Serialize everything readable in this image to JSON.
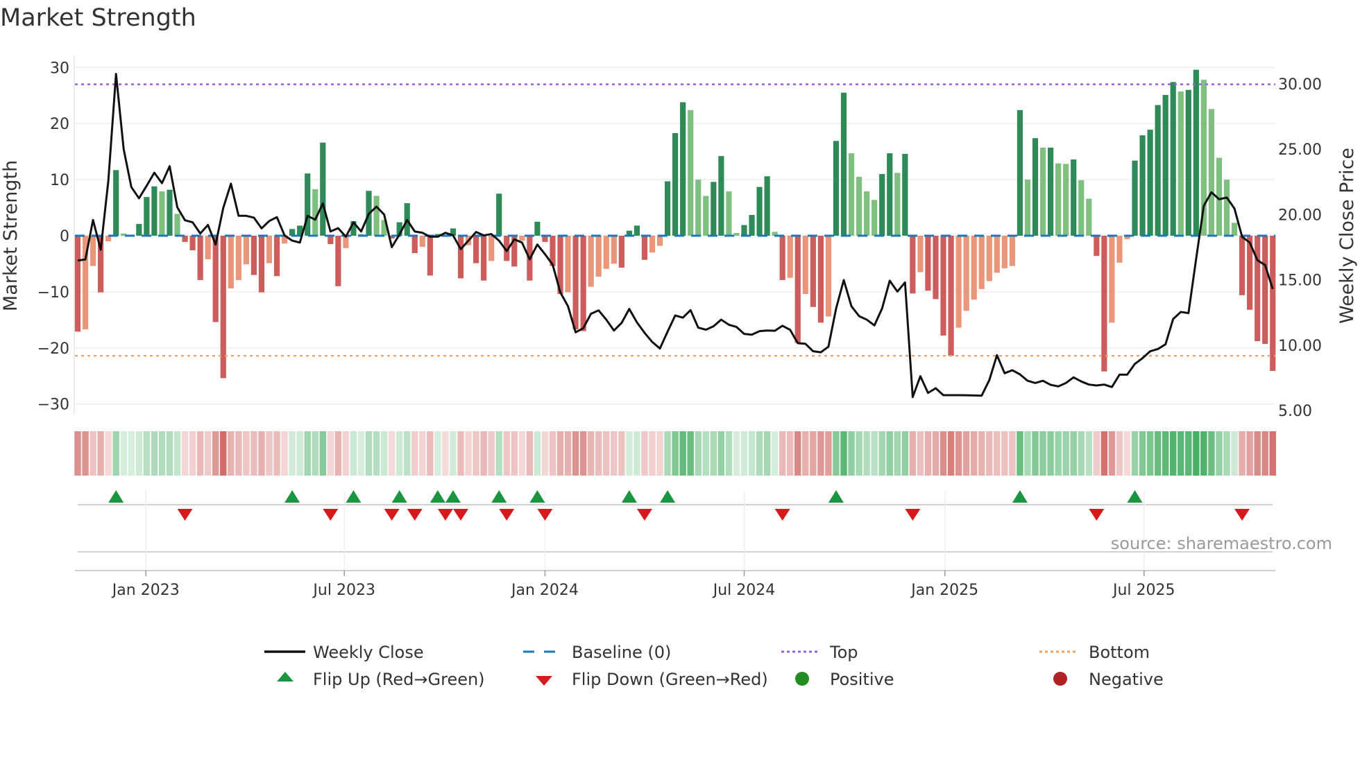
{
  "title": "Market Strength",
  "source": "source: sharemaestro.com",
  "colors": {
    "pos_rising": "#2e8b57",
    "pos_falling": "#7fbf7f",
    "neg_falling": "#cd5c5c",
    "neg_rising": "#e9967a",
    "close": "#111111",
    "baseline": "#1f77b4",
    "top": "#9b5de5",
    "bottom": "#f4a261",
    "flip_up": "#1a9641",
    "flip_down": "#d7191c",
    "positive": "#228b22",
    "negative": "#b22222"
  },
  "legend": {
    "weekly_close": "Weekly Close",
    "baseline": "Baseline (0)",
    "top": "Top",
    "bottom": "Bottom",
    "flip_up": "Flip Up (Red→Green)",
    "flip_down": "Flip Down (Green→Red)",
    "positive": "Positive",
    "negative": "Negative"
  },
  "chart_data": {
    "type": "bar",
    "title": "Market Strength",
    "ylabel": "Market Strength",
    "y2label": "Weekly Close Price",
    "ylim": [
      -32,
      32
    ],
    "y2lim": [
      4.5,
      31.5
    ],
    "yticks": [
      30,
      20,
      10,
      0,
      -10,
      -20,
      -30
    ],
    "ytick_labels": [
      "30",
      "20",
      "10",
      "0",
      "−10",
      "−20",
      "−30"
    ],
    "y2ticks": [
      30,
      25,
      20,
      15,
      10,
      5
    ],
    "y2tick_labels": [
      "30.00",
      "25.00",
      "20.00",
      "15.00",
      "10.00",
      "5.00"
    ],
    "top_level": 27,
    "bottom_level": -21.4,
    "baseline": 0,
    "x_ticks": [
      {
        "label": "Jan 2023",
        "week": 8.9
      },
      {
        "label": "Jul 2023",
        "week": 34.8
      },
      {
        "label": "Jan 2024",
        "week": 61.0
      },
      {
        "label": "Jul 2024",
        "week": 87.0
      },
      {
        "label": "Jan 2025",
        "week": 113.2
      },
      {
        "label": "Jul 2025",
        "week": 139.2
      }
    ],
    "strength": [
      -17.1,
      -16.7,
      -5.4,
      -10.1,
      -1.0,
      11.7,
      0.4,
      0.2,
      2.1,
      6.9,
      8.8,
      7.9,
      8.2,
      3.9,
      -1.1,
      -2.6,
      -7.9,
      -4.2,
      -15.4,
      -25.4,
      -9.4,
      -7.9,
      -5.1,
      -7.0,
      -10.1,
      -4.9,
      -7.2,
      -1.4,
      1.2,
      1.8,
      11.1,
      8.3,
      16.6,
      -1.5,
      -9.0,
      -2.2,
      2.6,
      0.3,
      8.0,
      7.1,
      2.8,
      -0.5,
      2.4,
      5.8,
      -3.1,
      -2.0,
      -7.1,
      0.3,
      -0.2,
      1.3,
      -7.6,
      -1.7,
      -4.9,
      -8.0,
      -4.5,
      7.5,
      -4.5,
      -5.5,
      -0.9,
      -8.0,
      2.5,
      -1.1,
      -5.4,
      -10.4,
      -10.1,
      -16.7,
      -17.0,
      -9.1,
      -7.3,
      -5.9,
      -5.0,
      -5.7,
      0.9,
      1.8,
      -4.3,
      -3.0,
      -1.8,
      9.7,
      18.3,
      23.8,
      22.4,
      10.0,
      7.1,
      9.6,
      14.2,
      7.9,
      0.5,
      1.9,
      3.7,
      8.7,
      10.6,
      0.7,
      -7.9,
      -7.5,
      -19.1,
      -10.4,
      -12.7,
      -15.5,
      -14.4,
      16.9,
      25.5,
      14.7,
      10.5,
      7.9,
      6.4,
      11.0,
      14.7,
      11.2,
      14.6,
      -10.3,
      -6.5,
      -9.8,
      -11.3,
      -17.8,
      -21.4,
      -16.4,
      -13.4,
      -11.4,
      -9.5,
      -8.1,
      -6.6,
      -5.8,
      -5.4,
      22.4,
      10.0,
      17.4,
      15.7,
      15.7,
      12.9,
      12.8,
      13.6,
      9.9,
      6.6,
      -3.6,
      -24.2,
      -15.5,
      -4.8,
      -0.6,
      13.4,
      17.9,
      18.9,
      23.3,
      25.1,
      27.4,
      25.7,
      26.0,
      29.6,
      27.8,
      22.6,
      13.9,
      10.0,
      2.3,
      -10.6,
      -13.2,
      -18.8,
      -19.3,
      -24.1
    ],
    "weekly_close": [
      16.48,
      16.56,
      19.58,
      17.3,
      22.6,
      30.76,
      25.0,
      22.1,
      21.24,
      22.2,
      23.2,
      22.4,
      23.7,
      20.55,
      19.56,
      19.4,
      18.55,
      19.2,
      17.7,
      20.5,
      22.36,
      19.9,
      19.9,
      19.76,
      18.94,
      19.5,
      19.8,
      18.4,
      18.0,
      17.85,
      19.9,
      19.6,
      20.85,
      18.7,
      18.95,
      18.3,
      19.4,
      18.7,
      20.05,
      20.6,
      20.0,
      17.5,
      18.47,
      19.58,
      18.7,
      18.6,
      18.3,
      18.3,
      18.6,
      18.4,
      17.35,
      18.0,
      18.66,
      18.4,
      18.5,
      18.0,
      17.2,
      18.1,
      17.85,
      16.57,
      17.7,
      16.96,
      16.16,
      14.04,
      12.98,
      10.98,
      11.3,
      12.4,
      12.66,
      11.95,
      11.12,
      11.7,
      12.77,
      11.74,
      10.94,
      10.24,
      9.74,
      11.03,
      12.27,
      12.1,
      12.68,
      11.34,
      11.18,
      11.44,
      11.95,
      11.56,
      11.39,
      10.86,
      10.8,
      11.07,
      11.12,
      11.1,
      11.48,
      11.17,
      10.15,
      10.1,
      9.53,
      9.45,
      9.88,
      12.8,
      14.98,
      12.98,
      12.22,
      11.95,
      11.51,
      12.8,
      14.93,
      14.1,
      14.8,
      6.02,
      7.62,
      6.34,
      6.7,
      6.17,
      6.17,
      6.17,
      6.16,
      6.15,
      6.13,
      7.32,
      9.23,
      7.85,
      8.08,
      7.76,
      7.27,
      7.1,
      7.27,
      6.96,
      6.84,
      7.1,
      7.53,
      7.22,
      6.98,
      6.91,
      6.98,
      6.79,
      7.74,
      7.74,
      8.56,
      9.0,
      9.53,
      9.7,
      10.06,
      12.0,
      12.54,
      12.45,
      16.6,
      20.67,
      21.7,
      21.17,
      21.3,
      20.46,
      18.3,
      17.85,
      16.5,
      16.13,
      14.3
    ]
  }
}
